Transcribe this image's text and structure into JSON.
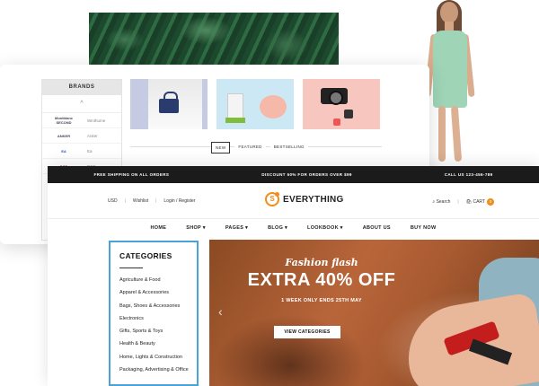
{
  "brands": {
    "title": "BRANDS",
    "up_arrow": "^",
    "items": [
      {
        "logo": "Montblanc SECOND",
        "name": "Winthume"
      },
      {
        "logo": "ANKER",
        "name": "Anker"
      },
      {
        "logo": "EA",
        "name": "Ea"
      },
      {
        "logo": "DCS",
        "name": "DCS"
      }
    ]
  },
  "product_tabs": [
    "NEW",
    "FEATURED",
    "BESTSELLING"
  ],
  "topbar": [
    "FREE SHIPPING ON ALL ORDERS",
    "DISCOUNT 50% FOR ORDERS OVER $99",
    "CALL US 123-456-789"
  ],
  "header": {
    "currency": "USD",
    "wishlist": "Wishlist",
    "login": "Login / Register",
    "logo_text": "EVERYTHING",
    "logo_mark": "S",
    "search": "Search",
    "cart": "CART",
    "cart_count": "0"
  },
  "nav": [
    "HOME",
    "SHOP ▾",
    "PAGES ▾",
    "BLOG ▾",
    "LOOKBOOK ▾",
    "ABOUT US",
    "BUY NOW"
  ],
  "categories": {
    "title": "CATEGORIES",
    "items": [
      "Agriculture & Food",
      "Apparel & Accessories",
      "Bags, Shoes & Accessories",
      "Electronics",
      "Gifts, Sports & Toys",
      "Health & Beauty",
      "Home, Lights & Construction",
      "Packaging, Advertising & Office"
    ]
  },
  "banner": {
    "script": "Fashion flash",
    "title": "EXTRA 40% OFF",
    "subtitle": "1 WEEK ONLY ENDS 25TH MAY",
    "button": "VIEW CATEGORIES",
    "prev": "‹"
  }
}
